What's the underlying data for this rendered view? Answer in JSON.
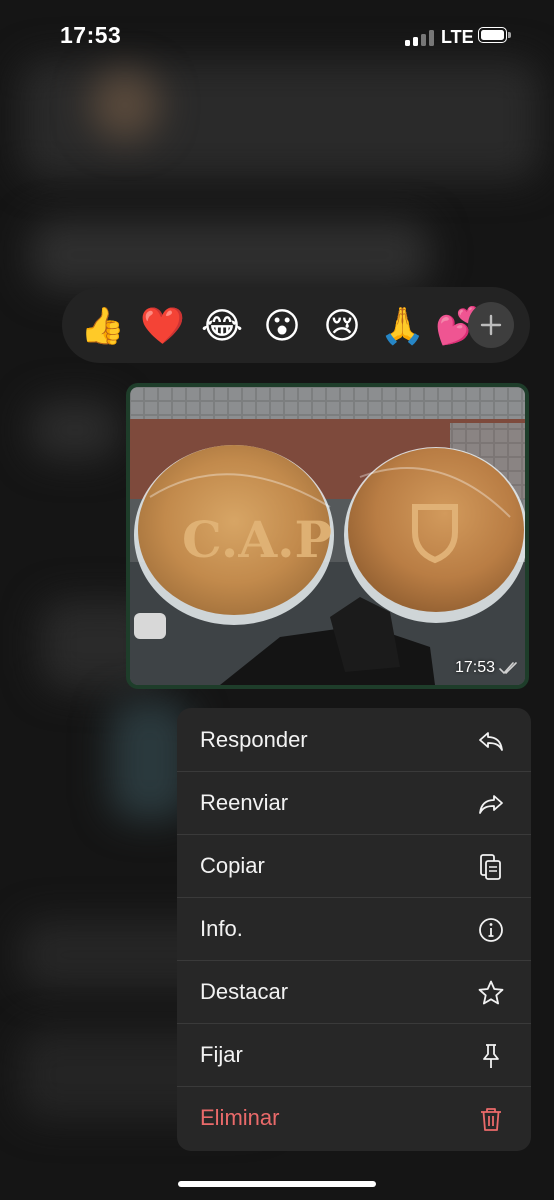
{
  "status_bar": {
    "time": "17:53",
    "network": "LTE"
  },
  "reactions": {
    "emojis": [
      "👍",
      "❤️",
      "😂",
      "😮",
      "😢",
      "🙏",
      "💕"
    ],
    "more_icon": "plus-icon"
  },
  "message": {
    "time": "17:53",
    "read_icon": "double-check-icon"
  },
  "menu": {
    "items": [
      {
        "label": "Responder",
        "icon": "reply-icon"
      },
      {
        "label": "Reenviar",
        "icon": "forward-icon"
      },
      {
        "label": "Copiar",
        "icon": "copy-icon"
      },
      {
        "label": "Info.",
        "icon": "info-icon"
      },
      {
        "label": "Destacar",
        "icon": "star-icon"
      },
      {
        "label": "Fijar",
        "icon": "pin-icon"
      },
      {
        "label": "Eliminar",
        "icon": "trash-icon"
      }
    ]
  },
  "colors": {
    "danger": "#ea6a6a",
    "bubble_border": "#1e3d2a"
  }
}
